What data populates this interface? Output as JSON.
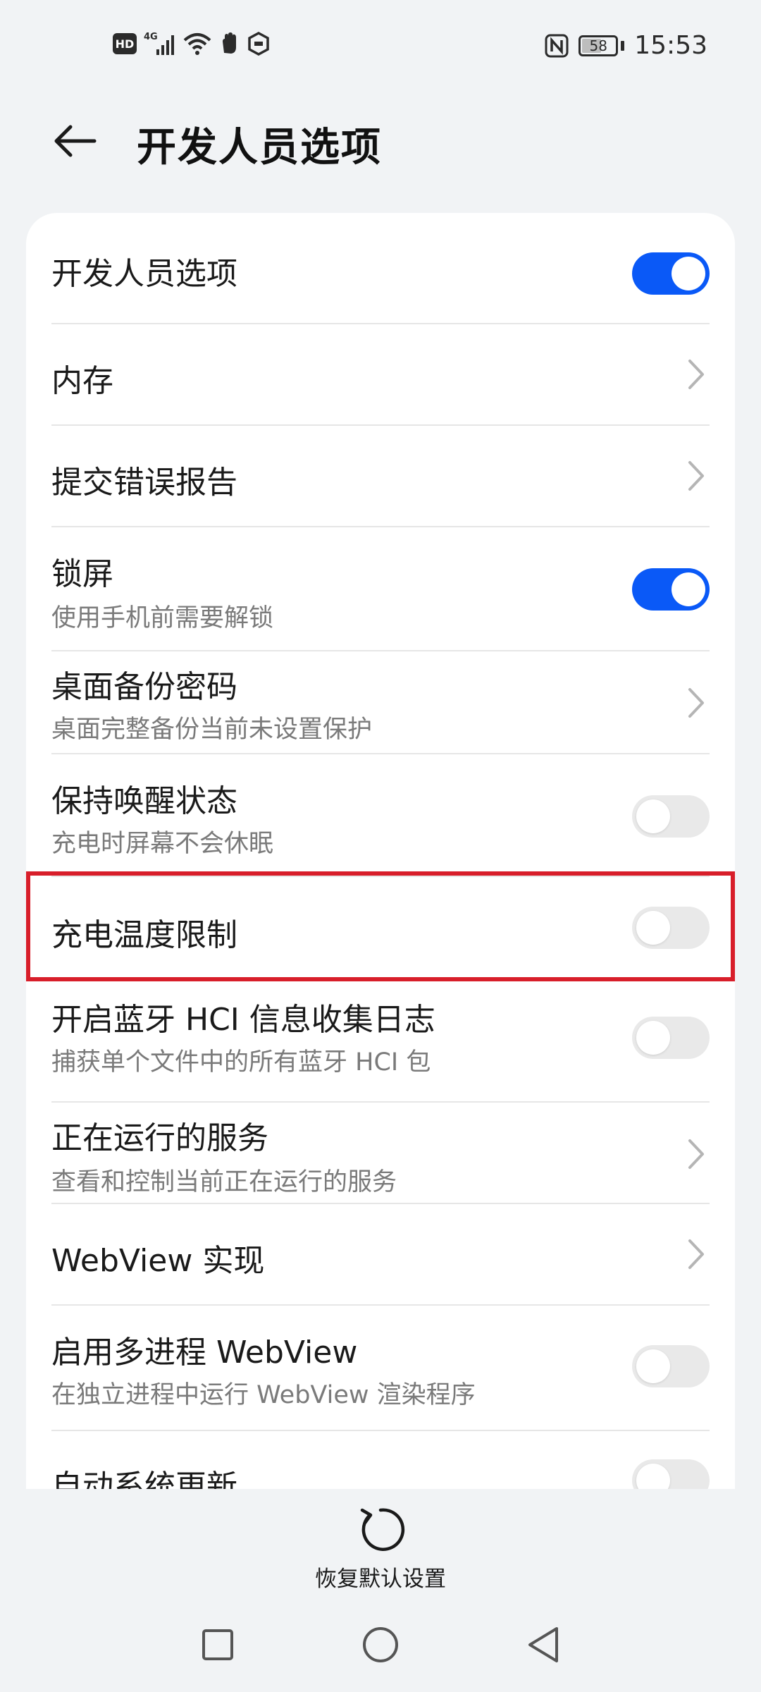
{
  "status_bar": {
    "hd_label": "HD",
    "network_label": "4G",
    "battery_level": 58,
    "battery_text": "58",
    "time": "15:53",
    "icons": [
      "hd-icon",
      "signal-icon",
      "wifi-icon",
      "hand-icon",
      "hexagon-icon",
      "nfc-icon",
      "battery-icon"
    ]
  },
  "header": {
    "back_icon": "arrow-left-icon",
    "title": "开发人员选项"
  },
  "settings": {
    "items": [
      {
        "title": "开发人员选项",
        "subtitle": "",
        "control": "toggle",
        "state": "on"
      },
      {
        "title": "内存",
        "subtitle": "",
        "control": "chevron"
      },
      {
        "title": "提交错误报告",
        "subtitle": "",
        "control": "chevron"
      },
      {
        "title": "锁屏",
        "subtitle": "使用手机前需要解锁",
        "control": "toggle",
        "state": "on"
      },
      {
        "title": "桌面备份密码",
        "subtitle": "桌面完整备份当前未设置保护",
        "control": "chevron"
      },
      {
        "title": "保持唤醒状态",
        "subtitle": "充电时屏幕不会休眠",
        "control": "toggle",
        "state": "off"
      },
      {
        "title": "充电温度限制",
        "subtitle": "",
        "control": "toggle",
        "state": "off",
        "highlighted": true
      },
      {
        "title": "开启蓝牙 HCI 信息收集日志",
        "subtitle": "捕获单个文件中的所有蓝牙 HCI 包",
        "control": "toggle",
        "state": "off"
      },
      {
        "title": "正在运行的服务",
        "subtitle": "查看和控制当前正在运行的服务",
        "control": "chevron"
      },
      {
        "title": "WebView 实现",
        "subtitle": "",
        "control": "chevron"
      },
      {
        "title": "启用多进程 WebView",
        "subtitle": "在独立进程中运行 WebView 渲染程序",
        "control": "toggle",
        "state": "off"
      },
      {
        "title": "自动系统更新",
        "subtitle": "",
        "control": "toggle",
        "state": "off"
      }
    ]
  },
  "footer": {
    "restore_icon": "refresh-icon",
    "restore_label": "恢复默认设置"
  },
  "nav_bar": {
    "icons": [
      "recent-apps-icon",
      "home-icon",
      "back-icon"
    ]
  },
  "colors": {
    "accent": "#0a59f7",
    "highlight": "#d81e2a",
    "background": "#f1f3f5",
    "card": "#ffffff",
    "toggle_off": "#e9e9e9"
  }
}
